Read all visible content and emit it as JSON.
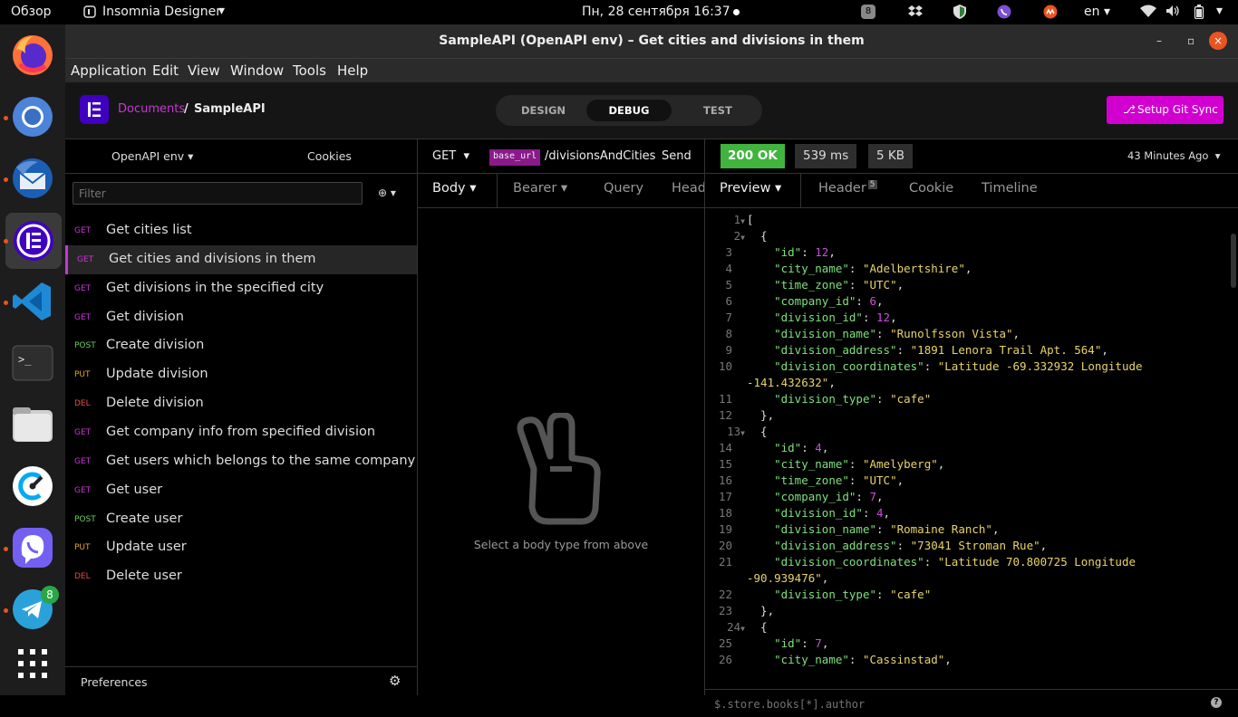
{
  "topbar": {
    "activities": "Обзор",
    "app_name": "Insomnia Designer",
    "datetime": "Пн, 28 сентября  16:37",
    "badge": "8",
    "lang": "en"
  },
  "window": {
    "title": "SampleAPI (OpenAPI env) – Get cities and divisions in them"
  },
  "menu": [
    "Application",
    "Edit",
    "View",
    "Window",
    "Tools",
    "Help"
  ],
  "header": {
    "breadcrumb_root": "Documents",
    "breadcrumb_sep": "/",
    "breadcrumb_current": "SampleAPI",
    "tabs": [
      "DESIGN",
      "DEBUG",
      "TEST"
    ],
    "active_tab": "DEBUG",
    "git_button": "Setup Git Sync"
  },
  "sidebar": {
    "environment": "OpenAPI env",
    "cookies": "Cookies",
    "filter_placeholder": "Filter",
    "preferences": "Preferences",
    "requests": [
      {
        "method": "GET",
        "name": "Get cities list",
        "active": false
      },
      {
        "method": "GET",
        "name": "Get cities and divisions in them",
        "active": true
      },
      {
        "method": "GET",
        "name": "Get divisions in the specified city",
        "active": false
      },
      {
        "method": "GET",
        "name": "Get division",
        "active": false
      },
      {
        "method": "POST",
        "name": "Create division",
        "active": false
      },
      {
        "method": "PUT",
        "name": "Update division",
        "active": false
      },
      {
        "method": "DEL",
        "name": "Delete division",
        "active": false
      },
      {
        "method": "GET",
        "name": "Get company info from specified division",
        "active": false
      },
      {
        "method": "GET",
        "name": "Get users which belongs to the same company",
        "active": false
      },
      {
        "method": "GET",
        "name": "Get user",
        "active": false
      },
      {
        "method": "POST",
        "name": "Create user",
        "active": false
      },
      {
        "method": "PUT",
        "name": "Update user",
        "active": false
      },
      {
        "method": "DEL",
        "name": "Delete user",
        "active": false
      }
    ]
  },
  "request": {
    "method": "GET",
    "url_var": "base_url",
    "url_path": "/divisionsAndCities",
    "send": "Send",
    "tabs": [
      "Body",
      "Bearer",
      "Query",
      "Head"
    ],
    "empty_message": "Select a body type from above"
  },
  "response": {
    "status": "200 OK",
    "time": "539 ms",
    "size": "5 KB",
    "age": "43 Minutes Ago",
    "tabs": [
      "Preview",
      "Header",
      "Cookie",
      "Timeline"
    ],
    "header_count": "5",
    "filter_placeholder": "$.store.books[*].author",
    "lines": [
      {
        "n": "1",
        "fold": true,
        "t": [
          [
            "p",
            "["
          ]
        ]
      },
      {
        "n": "2",
        "fold": true,
        "t": [
          [
            "p",
            "  {"
          ]
        ]
      },
      {
        "n": "3",
        "t": [
          [
            "p",
            "    "
          ],
          [
            "k",
            "\"id\""
          ],
          [
            "p",
            ": "
          ],
          [
            "n",
            "12"
          ],
          [
            "p",
            ","
          ]
        ]
      },
      {
        "n": "4",
        "t": [
          [
            "p",
            "    "
          ],
          [
            "k",
            "\"city_name\""
          ],
          [
            "p",
            ": "
          ],
          [
            "s",
            "\"Adelbertshire\""
          ],
          [
            "p",
            ","
          ]
        ]
      },
      {
        "n": "5",
        "t": [
          [
            "p",
            "    "
          ],
          [
            "k",
            "\"time_zone\""
          ],
          [
            "p",
            ": "
          ],
          [
            "s",
            "\"UTC\""
          ],
          [
            "p",
            ","
          ]
        ]
      },
      {
        "n": "6",
        "t": [
          [
            "p",
            "    "
          ],
          [
            "k",
            "\"company_id\""
          ],
          [
            "p",
            ": "
          ],
          [
            "n",
            "6"
          ],
          [
            "p",
            ","
          ]
        ]
      },
      {
        "n": "7",
        "t": [
          [
            "p",
            "    "
          ],
          [
            "k",
            "\"division_id\""
          ],
          [
            "p",
            ": "
          ],
          [
            "n",
            "12"
          ],
          [
            "p",
            ","
          ]
        ]
      },
      {
        "n": "8",
        "t": [
          [
            "p",
            "    "
          ],
          [
            "k",
            "\"division_name\""
          ],
          [
            "p",
            ": "
          ],
          [
            "s",
            "\"Runolfsson Vista\""
          ],
          [
            "p",
            ","
          ]
        ]
      },
      {
        "n": "9",
        "t": [
          [
            "p",
            "    "
          ],
          [
            "k",
            "\"division_address\""
          ],
          [
            "p",
            ": "
          ],
          [
            "s",
            "\"1891 Lenora Trail Apt. 564\""
          ],
          [
            "p",
            ","
          ]
        ]
      },
      {
        "n": "10",
        "t": [
          [
            "p",
            "    "
          ],
          [
            "k",
            "\"division_coordinates\""
          ],
          [
            "p",
            ": "
          ],
          [
            "s",
            "\"Latitude -69.332932 Longitude"
          ]
        ]
      },
      {
        "n": "",
        "wrap": true,
        "t": [
          [
            "s",
            "-141.432632\""
          ],
          [
            "p",
            ","
          ]
        ]
      },
      {
        "n": "11",
        "t": [
          [
            "p",
            "    "
          ],
          [
            "k",
            "\"division_type\""
          ],
          [
            "p",
            ": "
          ],
          [
            "s",
            "\"cafe\""
          ]
        ]
      },
      {
        "n": "12",
        "t": [
          [
            "p",
            "  },"
          ]
        ]
      },
      {
        "n": "13",
        "fold": true,
        "t": [
          [
            "p",
            "  {"
          ]
        ]
      },
      {
        "n": "14",
        "t": [
          [
            "p",
            "    "
          ],
          [
            "k",
            "\"id\""
          ],
          [
            "p",
            ": "
          ],
          [
            "n",
            "4"
          ],
          [
            "p",
            ","
          ]
        ]
      },
      {
        "n": "15",
        "t": [
          [
            "p",
            "    "
          ],
          [
            "k",
            "\"city_name\""
          ],
          [
            "p",
            ": "
          ],
          [
            "s",
            "\"Amelyberg\""
          ],
          [
            "p",
            ","
          ]
        ]
      },
      {
        "n": "16",
        "t": [
          [
            "p",
            "    "
          ],
          [
            "k",
            "\"time_zone\""
          ],
          [
            "p",
            ": "
          ],
          [
            "s",
            "\"UTC\""
          ],
          [
            "p",
            ","
          ]
        ]
      },
      {
        "n": "17",
        "t": [
          [
            "p",
            "    "
          ],
          [
            "k",
            "\"company_id\""
          ],
          [
            "p",
            ": "
          ],
          [
            "n",
            "7"
          ],
          [
            "p",
            ","
          ]
        ]
      },
      {
        "n": "18",
        "t": [
          [
            "p",
            "    "
          ],
          [
            "k",
            "\"division_id\""
          ],
          [
            "p",
            ": "
          ],
          [
            "n",
            "4"
          ],
          [
            "p",
            ","
          ]
        ]
      },
      {
        "n": "19",
        "t": [
          [
            "p",
            "    "
          ],
          [
            "k",
            "\"division_name\""
          ],
          [
            "p",
            ": "
          ],
          [
            "s",
            "\"Romaine Ranch\""
          ],
          [
            "p",
            ","
          ]
        ]
      },
      {
        "n": "20",
        "t": [
          [
            "p",
            "    "
          ],
          [
            "k",
            "\"division_address\""
          ],
          [
            "p",
            ": "
          ],
          [
            "s",
            "\"73041 Stroman Rue\""
          ],
          [
            "p",
            ","
          ]
        ]
      },
      {
        "n": "21",
        "t": [
          [
            "p",
            "    "
          ],
          [
            "k",
            "\"division_coordinates\""
          ],
          [
            "p",
            ": "
          ],
          [
            "s",
            "\"Latitude 70.800725 Longitude"
          ]
        ]
      },
      {
        "n": "",
        "wrap": true,
        "t": [
          [
            "s",
            "-90.939476\""
          ],
          [
            "p",
            ","
          ]
        ]
      },
      {
        "n": "22",
        "t": [
          [
            "p",
            "    "
          ],
          [
            "k",
            "\"division_type\""
          ],
          [
            "p",
            ": "
          ],
          [
            "s",
            "\"cafe\""
          ]
        ]
      },
      {
        "n": "23",
        "t": [
          [
            "p",
            "  },"
          ]
        ]
      },
      {
        "n": "24",
        "fold": true,
        "t": [
          [
            "p",
            "  {"
          ]
        ]
      },
      {
        "n": "25",
        "t": [
          [
            "p",
            "    "
          ],
          [
            "k",
            "\"id\""
          ],
          [
            "p",
            ": "
          ],
          [
            "n",
            "7"
          ],
          [
            "p",
            ","
          ]
        ]
      },
      {
        "n": "26",
        "t": [
          [
            "p",
            "    "
          ],
          [
            "k",
            "\"city_name\""
          ],
          [
            "p",
            ": "
          ],
          [
            "s",
            "\"Cassinstad\""
          ],
          [
            "p",
            ","
          ]
        ]
      }
    ]
  },
  "dock": [
    {
      "name": "Firefox",
      "icon": "firefox-icon"
    },
    {
      "name": "Chromium",
      "icon": "chromium-icon"
    },
    {
      "name": "Thunderbird",
      "icon": "thunderbird-icon"
    },
    {
      "name": "Insomnia",
      "icon": "insomnia-icon"
    },
    {
      "name": "VS Code",
      "icon": "vscode-icon"
    },
    {
      "name": "Terminal",
      "icon": "terminal-icon"
    },
    {
      "name": "Files",
      "icon": "files-icon"
    },
    {
      "name": "Clockify",
      "icon": "clockify-icon"
    },
    {
      "name": "Viber",
      "icon": "viber-icon"
    },
    {
      "name": "Telegram",
      "icon": "telegram-icon",
      "badge": "8"
    },
    {
      "name": "Show Applications",
      "icon": "app-grid-icon"
    }
  ]
}
